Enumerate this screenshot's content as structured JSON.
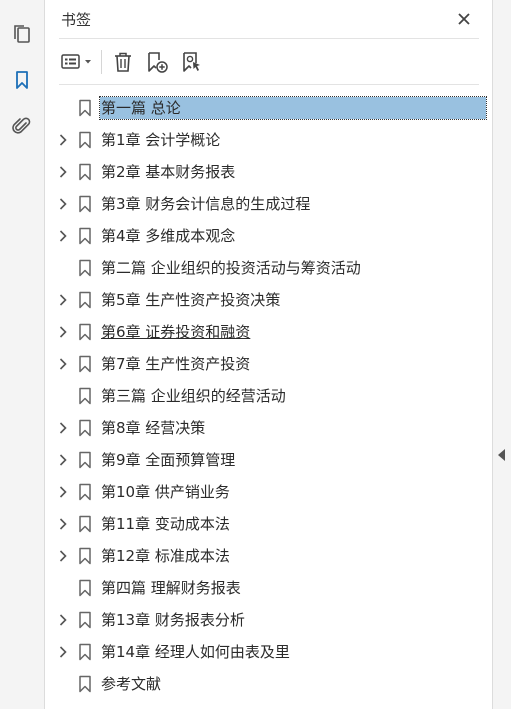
{
  "panel": {
    "title": "书签"
  },
  "rail": {
    "items": [
      {
        "icon": "pages-icon"
      },
      {
        "icon": "bookmark-icon",
        "active": true
      },
      {
        "icon": "attachment-icon"
      }
    ]
  },
  "toolbar": {
    "options_icon": "list-options-icon",
    "delete_icon": "trash-icon",
    "new_bookmark_icon": "add-bookmark-icon",
    "bookmark_from_selection_icon": "bookmark-selection-icon"
  },
  "colors": {
    "accent": "#1c6fb7",
    "selection": "#99c1e0"
  },
  "bookmarks": [
    {
      "label": "第一篇 总论",
      "expandable": false,
      "selected": true
    },
    {
      "label": "第1章 会计学概论",
      "expandable": true
    },
    {
      "label": "第2章 基本财务报表",
      "expandable": true
    },
    {
      "label": "第3章 财务会计信息的生成过程",
      "expandable": true
    },
    {
      "label": "第4章 多维成本观念",
      "expandable": true
    },
    {
      "label": "第二篇 企业组织的投资活动与筹资活动",
      "expandable": false
    },
    {
      "label": "第5章 生产性资产投资决策",
      "expandable": true
    },
    {
      "label": "第6章 证券投资和融资",
      "expandable": true,
      "underlined": true
    },
    {
      "label": "第7章 生产性资产投资",
      "expandable": true
    },
    {
      "label": "第三篇 企业组织的经营活动",
      "expandable": false
    },
    {
      "label": "第8章 经营决策",
      "expandable": true
    },
    {
      "label": "第9章 全面预算管理",
      "expandable": true
    },
    {
      "label": "第10章 供产销业务",
      "expandable": true
    },
    {
      "label": "第11章 变动成本法",
      "expandable": true
    },
    {
      "label": "第12章 标准成本法",
      "expandable": true
    },
    {
      "label": "第四篇 理解财务报表",
      "expandable": false
    },
    {
      "label": "第13章 财务报表分析",
      "expandable": true
    },
    {
      "label": "第14章 经理人如何由表及里",
      "expandable": true
    },
    {
      "label": "参考文献",
      "expandable": false
    }
  ]
}
